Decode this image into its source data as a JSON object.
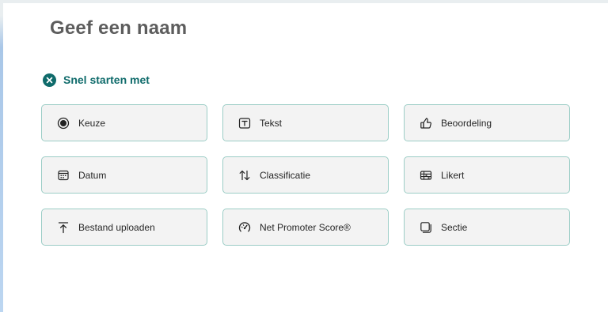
{
  "form": {
    "title": "Geef een naam"
  },
  "quick_start": {
    "label": "Snel starten met"
  },
  "question_types": [
    {
      "label": "Keuze",
      "icon": "radio-icon"
    },
    {
      "label": "Tekst",
      "icon": "text-box-icon"
    },
    {
      "label": "Beoordeling",
      "icon": "thumbs-up-icon"
    },
    {
      "label": "Datum",
      "icon": "calendar-icon"
    },
    {
      "label": "Classificatie",
      "icon": "sort-arrows-icon"
    },
    {
      "label": "Likert",
      "icon": "likert-grid-icon"
    },
    {
      "label": "Bestand uploaden",
      "icon": "upload-icon"
    },
    {
      "label": "Net Promoter Score®",
      "icon": "gauge-icon"
    },
    {
      "label": "Sectie",
      "icon": "section-icon"
    }
  ],
  "colors": {
    "accent": "#0f6b6b",
    "tile_background": "#f3f3f3",
    "tile_border": "#9ccdc6",
    "title_text": "#5d5d5d"
  }
}
